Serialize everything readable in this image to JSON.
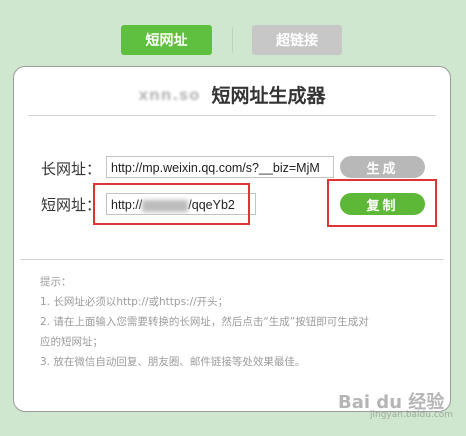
{
  "tabs": {
    "short_url": "短网址",
    "hyperlink": "超链接"
  },
  "card": {
    "title": "短网址生成器",
    "logo_text": "xnn.so"
  },
  "long_url": {
    "label": "长网址：",
    "value": "http://mp.weixin.qq.com/s?__biz=MjM",
    "button": "生成"
  },
  "short_url": {
    "label": "短网址：",
    "value_prefix": "http://",
    "value_suffix": "/qqeYb2",
    "button": "复制"
  },
  "tips": {
    "heading": "提示：",
    "items": [
      "1. 长网址必须以http://或https://开头；",
      "2. 请在上面输入您需要转换的长网址，然后点击“生成”按钮即可生成对",
      "应的短网址；",
      "3. 放在微信自动回复、朋友圈、邮件链接等处效果最佳。"
    ]
  },
  "watermark": {
    "main": "Bai du 经验",
    "sub": "jingyan.baidu.com"
  },
  "colors": {
    "accent": "#5fbf3f",
    "background": "#cfe7cf",
    "highlight": "#e03434"
  }
}
